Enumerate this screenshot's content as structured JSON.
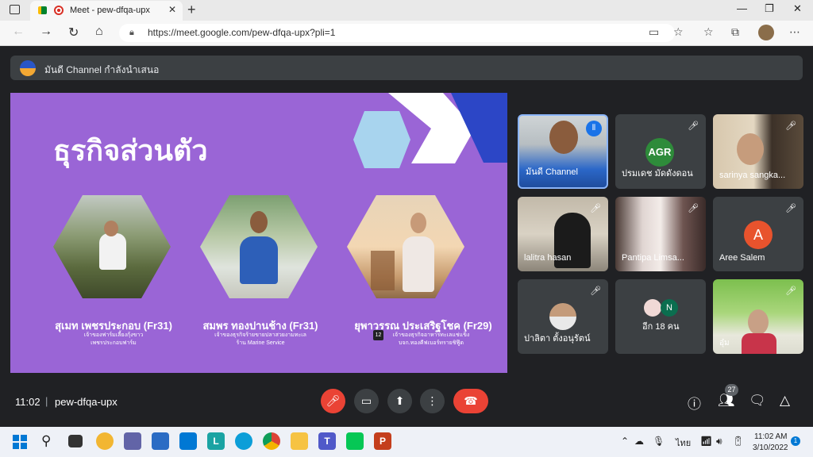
{
  "browser": {
    "tab_title": "Meet - pew-dfqa-upx",
    "new_tab": "+",
    "url": "https://meet.google.com/pew-dfqa-upx?pli=1"
  },
  "presenting_banner": "มันดี Channel กำลังนำเสนอ",
  "slide": {
    "title": "ธุรกิจส่วนตัว",
    "people": [
      {
        "name": "สุเมท เพชรประกอบ (Fr31)",
        "desc1": "เจ้าของฟาร์มเลี้ยงกุ้งขาว",
        "desc2": "เพชรประกอบฟาร์ม"
      },
      {
        "name": "สมพร ทองปานช้าง (Fr31)",
        "desc1": "เจ้าของธุรกิจร้ายขายปลาสวยงามทะเล",
        "desc2": "ร้าน Marine Service"
      },
      {
        "name": "ยุพาวรรณ ประเสริฐโชค (Fr29)",
        "desc1": "เจ้าของธุรกิจอาหารทะเลแช่แข็ง",
        "desc2": "บจก.ทองคีฟเบอร์ทรายชิฟู๊ด",
        "badge": "12"
      }
    ]
  },
  "participants": [
    {
      "name": "มันดี Channel",
      "speaking": true
    },
    {
      "name": "ปรมเดช มัดดังดอน",
      "avatar_text": "AGR"
    },
    {
      "name": "sarinya sangka..."
    },
    {
      "name": "lalitra hasan"
    },
    {
      "name": "Pantipa Limsa..."
    },
    {
      "name": "Aree Salem",
      "avatar_text": "A"
    },
    {
      "name": "ปาลิตา ตั้งอนุรัตน์"
    },
    {
      "name": "อีก 18 คน",
      "avatar_text": "N"
    },
    {
      "name": "อุ๋ม"
    }
  ],
  "meeting": {
    "time": "11:02",
    "separator": "|",
    "code": "pew-dfqa-upx",
    "people_count": "27"
  },
  "taskbar": {
    "lang": "ไทย",
    "clock_time": "11:02 AM",
    "clock_date": "3/10/2022",
    "notification_count": "1"
  },
  "colors": {
    "slide_bg": "#9a65d6",
    "accent_blue": "#8ab4f8",
    "end_call": "#ea4335"
  }
}
